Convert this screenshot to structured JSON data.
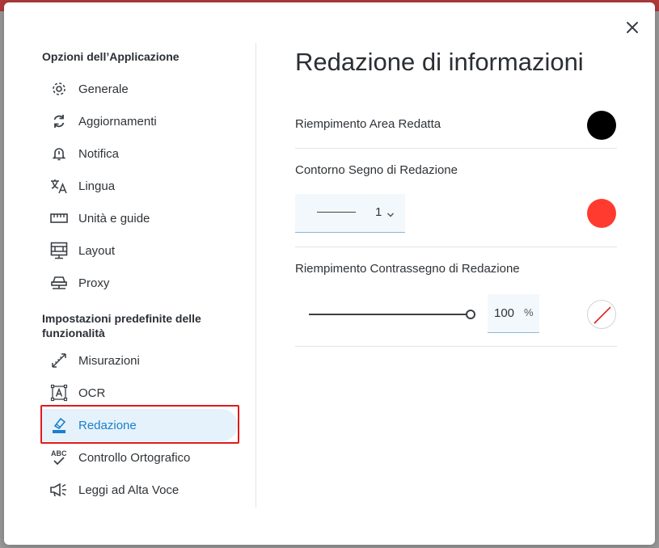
{
  "colors": {
    "accent": "#1b7fcc",
    "active_bg": "#e6f2fb",
    "highlight_border": "#e01b1b",
    "fill_swatch": "#000000",
    "outline_swatch": "#ff3b2f"
  },
  "dialog": {
    "close_icon": "close-icon"
  },
  "sidebar": {
    "app_options_title": "Opzioni dell’Applicazione",
    "app_items": [
      {
        "label": "Generale",
        "icon": "gear-icon"
      },
      {
        "label": "Aggiornamenti",
        "icon": "refresh-icon"
      },
      {
        "label": "Notifica",
        "icon": "bell-icon"
      },
      {
        "label": "Lingua",
        "icon": "translate-icon"
      },
      {
        "label": "Unità e guide",
        "icon": "ruler-icon"
      },
      {
        "label": "Layout",
        "icon": "layout-icon"
      },
      {
        "label": "Proxy",
        "icon": "proxy-icon"
      }
    ],
    "feature_title_line1": "Impostazioni predefinite delle",
    "feature_title_line2": "funzionalità",
    "feature_items": [
      {
        "label": "Misurazioni",
        "icon": "measure-icon"
      },
      {
        "label": "OCR",
        "icon": "ocr-icon"
      },
      {
        "label": "Redazione",
        "icon": "redact-icon",
        "active": true
      },
      {
        "label": "Controllo Ortografico",
        "icon": "spellcheck-icon"
      },
      {
        "label": "Leggi ad Alta Voce",
        "icon": "read-aloud-icon"
      }
    ]
  },
  "main": {
    "title": "Redazione di informazioni",
    "fill_area_label": "Riempimento Area Redatta",
    "outline_label": "Contorno Segno di Redazione",
    "outline_width": "1",
    "mark_fill_label": "Riempimento Contrassegno di Redazione",
    "opacity_value": "100",
    "opacity_unit": "%",
    "opacity_slider_level": 1.0
  }
}
